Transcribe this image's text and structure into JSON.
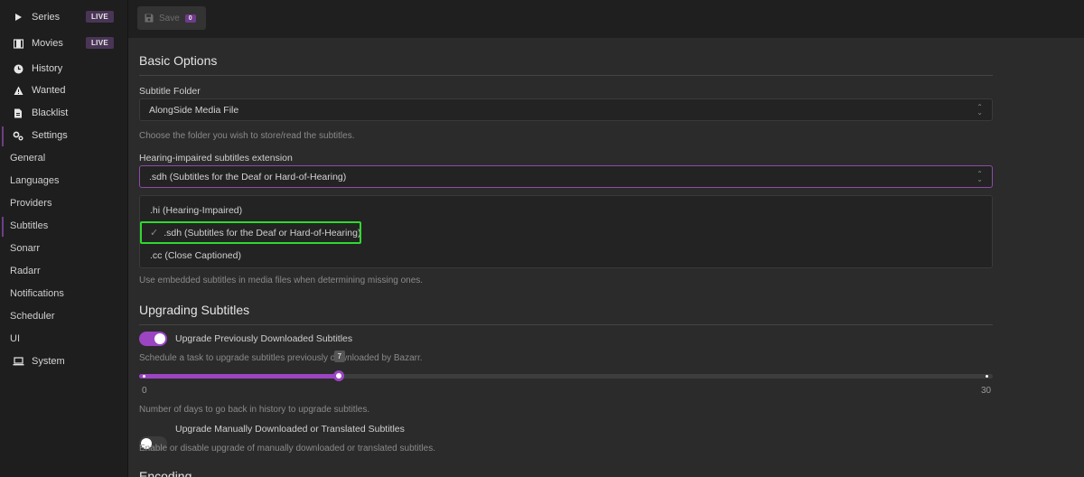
{
  "sidebar": {
    "nav": [
      {
        "label": "Series",
        "icon": "play-icon",
        "badge": "LIVE"
      },
      {
        "label": "Movies",
        "icon": "film-icon",
        "badge": "LIVE"
      },
      {
        "label": "History",
        "icon": "clock-icon"
      },
      {
        "label": "Wanted",
        "icon": "warning-icon"
      },
      {
        "label": "Blacklist",
        "icon": "file-icon"
      },
      {
        "label": "Settings",
        "icon": "gears-icon"
      }
    ],
    "settings_items": [
      "General",
      "Languages",
      "Providers",
      "Subtitles",
      "Sonarr",
      "Radarr",
      "Notifications",
      "Scheduler",
      "UI"
    ],
    "system": {
      "label": "System",
      "icon": "laptop-icon"
    }
  },
  "toolbar": {
    "save_label": "Save",
    "save_count": "0"
  },
  "basic": {
    "title": "Basic Options",
    "subtitle_folder_label": "Subtitle Folder",
    "subtitle_folder_value": "AlongSide Media File",
    "subtitle_folder_help": "Choose the folder you wish to store/read the subtitles.",
    "hi_label": "Hearing-impaired subtitles extension",
    "hi_value": ".sdh (Subtitles for the Deaf or Hard-of-Hearing)",
    "hi_options": [
      ".hi (Hearing-Impaired)",
      ".sdh (Subtitles for the Deaf or Hard-of-Hearing)",
      ".cc (Close Captioned)"
    ],
    "embedded_help": "Use embedded subtitles in media files when determining missing ones."
  },
  "upgrading": {
    "title": "Upgrading Subtitles",
    "upgrade_prev_label": "Upgrade Previously Downloaded Subtitles",
    "upgrade_prev_help": "Schedule a task to upgrade subtitles previously downloaded by Bazarr.",
    "slider": {
      "min": "0",
      "max": "30",
      "value": 7
    },
    "slider_help": "Number of days to go back in history to upgrade subtitles.",
    "upgrade_manual_label": "Upgrade Manually Downloaded or Translated Subtitles",
    "upgrade_manual_help": "Enable or disable upgrade of manually downloaded or translated subtitles."
  },
  "encoding": {
    "title": "Encoding"
  }
}
